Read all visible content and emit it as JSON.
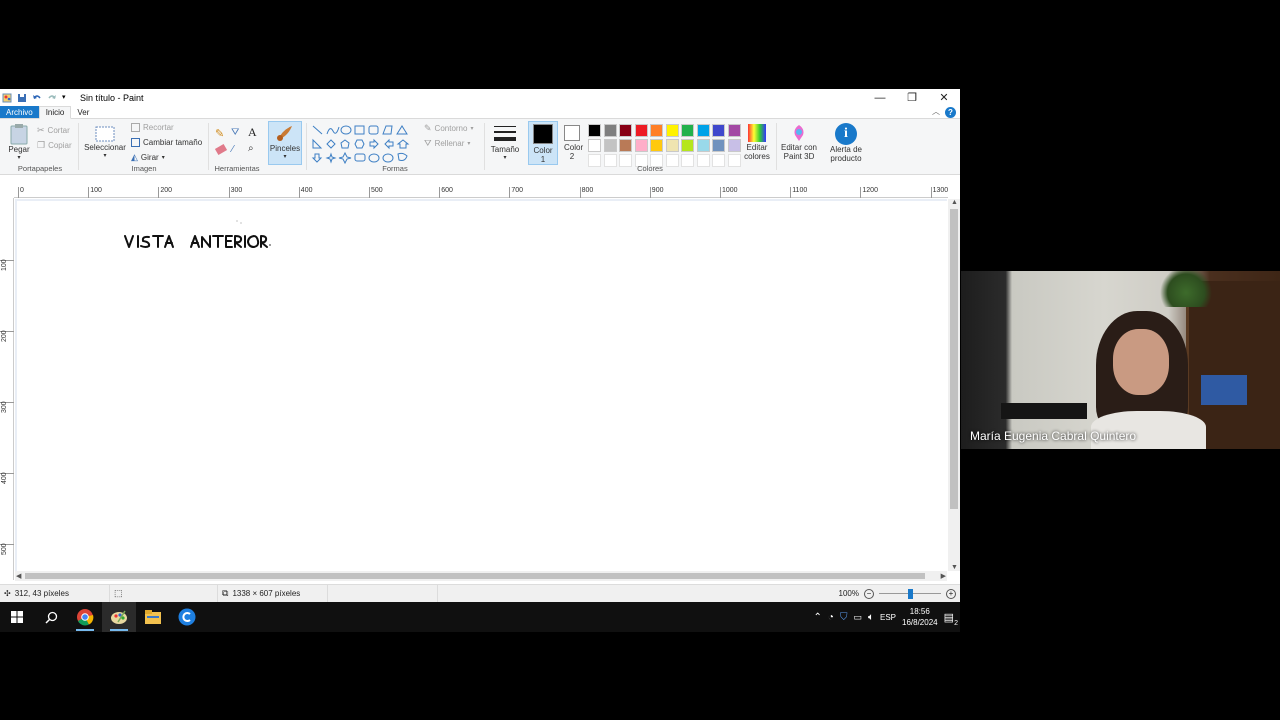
{
  "window": {
    "title": "Sin título - Paint",
    "minimize_icon": "minimize-icon",
    "maximize_icon": "restore-icon",
    "close_icon": "close-icon"
  },
  "tabs": [
    "Archivo",
    "Inicio",
    "Ver"
  ],
  "ribbon": {
    "clipboard": {
      "paste": "Pegar",
      "cut": "Cortar",
      "copy": "Copiar",
      "group": "Portapapeles"
    },
    "image": {
      "select": "Seleccionar",
      "crop": "Recortar",
      "resize": "Cambiar tamaño",
      "rotate": "Girar",
      "group": "Imagen"
    },
    "tools": {
      "group": "Herramientas",
      "brushes": "Pinceles"
    },
    "shapes": {
      "outline": "Contorno",
      "fill": "Rellenar",
      "group": "Formas"
    },
    "size": "Tamaño",
    "color1": "Color 1",
    "color2": "Color 2",
    "colors_group": "Colores",
    "edit_colors": "Editar colores",
    "paint3d": "Editar con Paint 3D",
    "product_alert": "Alerta de producto"
  },
  "palette": {
    "row1": [
      "#000000",
      "#7f7f7f",
      "#880015",
      "#ed1c24",
      "#ff7f27",
      "#fff200",
      "#22b14c",
      "#00a2e8",
      "#3f48cc",
      "#a349a4"
    ],
    "row2": [
      "#ffffff",
      "#c3c3c3",
      "#b97a57",
      "#ffaec9",
      "#ffc90e",
      "#efe4b0",
      "#b5e61d",
      "#99d9ea",
      "#7092be",
      "#c8bfe7"
    ]
  },
  "ruler": {
    "h_labels": [
      "0",
      "100",
      "200",
      "300",
      "400",
      "500",
      "600",
      "700",
      "800",
      "900",
      "1000",
      "1100",
      "1200",
      "1300"
    ],
    "v_labels": [
      "100",
      "200",
      "300",
      "400",
      "500"
    ]
  },
  "canvas": {
    "handwriting": "VISTA ANTERIOR"
  },
  "status": {
    "cursor_pos": "312, 43 píxeles",
    "canvas_size": "1338 × 607 píxeles",
    "zoom": "100%"
  },
  "taskbar": {
    "lang": "ESP",
    "time": "18:56",
    "date": "16/8/2024",
    "notifications": "2"
  },
  "webcam": {
    "name": "María Eugenia Cabral Quintero"
  }
}
